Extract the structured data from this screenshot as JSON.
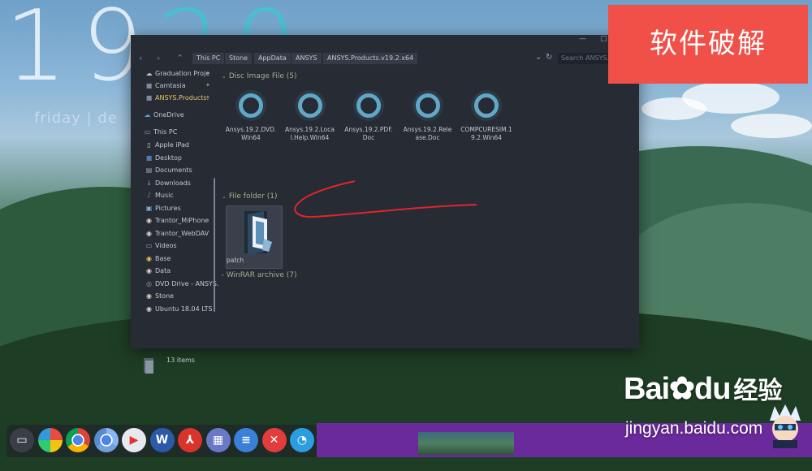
{
  "desktop": {
    "clock_digits": "19",
    "clock_accent": "20",
    "dateline": "friday | de"
  },
  "badge": {
    "text": "软件破解"
  },
  "explorer": {
    "window_controls": {
      "minimize": "—",
      "maximize": "□",
      "close": "✕"
    },
    "address": {
      "back": "‹",
      "forward": "›",
      "up": "⌃",
      "crumbs": [
        "This PC",
        "Stone",
        "AppData",
        "ANSYS",
        "ANSYS.Products.v19.2.x64"
      ],
      "dropdown": "⌄",
      "refresh": "↻",
      "search_placeholder": "Search ANSYS.Pro..."
    },
    "nav": {
      "quick_access": [
        {
          "label": "Graduation Proje",
          "icon": "☁",
          "pinned": true
        },
        {
          "label": "Camtasia",
          "icon": "■",
          "pinned": true
        },
        {
          "label": "ANSYS.Products.",
          "icon": "■",
          "pinned": true,
          "active": true
        }
      ],
      "onedrive": "OneDrive",
      "this_pc": "This PC",
      "pc_items": [
        {
          "label": "Apple iPad",
          "icon": "▯"
        },
        {
          "label": "Desktop",
          "icon": "■"
        },
        {
          "label": "Documents",
          "icon": "▤"
        },
        {
          "label": "Downloads",
          "icon": "↓"
        },
        {
          "label": "Music",
          "icon": "♪"
        },
        {
          "label": "Pictures",
          "icon": "▣"
        },
        {
          "label": "Trantor_MiPhone",
          "icon": "◉"
        },
        {
          "label": "Trantor_WebDAV",
          "icon": "◉"
        },
        {
          "label": "Videos",
          "icon": "▭"
        },
        {
          "label": "Base",
          "icon": "◉"
        },
        {
          "label": "Data",
          "icon": "◉"
        },
        {
          "label": "DVD Drive - ANSYS.",
          "icon": "◎"
        },
        {
          "label": "Stone",
          "icon": "◉"
        },
        {
          "label": "Ubuntu 18.04 LTS",
          "icon": "◉"
        }
      ]
    },
    "status": {
      "items": "13 items"
    },
    "groups": {
      "disc": {
        "header": "Disc Image File (5)",
        "files": [
          "Ansys.19.2.DVD.Win64",
          "Ansys.19.2.Local.Help.Win64",
          "Ansys.19.2.PDF.Doc",
          "Ansys.19.2.Release.Doc",
          "COMPCURESIM.19.2.Win64"
        ]
      },
      "folder": {
        "header": "File folder (1)",
        "files": [
          "patch"
        ]
      },
      "winrar": {
        "header": "WinRAR archive (7)"
      }
    }
  },
  "taskbar": {
    "apps": [
      {
        "name": "screen-app",
        "glyph": "▭",
        "color": "#3a3f47"
      },
      {
        "name": "colors-app",
        "glyph": "",
        "color": "#e9b930"
      },
      {
        "name": "chrome",
        "glyph": "",
        "color": "#d94c3b"
      },
      {
        "name": "chromium",
        "glyph": "",
        "color": "#4a86c5"
      },
      {
        "name": "video-app",
        "glyph": "▶",
        "color": "#e6eaee"
      },
      {
        "name": "word",
        "glyph": "W",
        "color": "#2b5aa8"
      },
      {
        "name": "pdf",
        "glyph": "⅄",
        "color": "#d8342c"
      },
      {
        "name": "docs-viewer",
        "glyph": "▦",
        "color": "#6a78c8"
      },
      {
        "name": "notes",
        "glyph": "≡",
        "color": "#3a7fd8"
      },
      {
        "name": "xmind",
        "glyph": "✕",
        "color": "#e23c3c"
      },
      {
        "name": "chat",
        "glyph": "◔",
        "color": "#2a9ee0"
      }
    ]
  },
  "watermark": {
    "logo": "Bai",
    "logo2": "du",
    "cn": "经验",
    "url": "jingyan.baidu.com"
  }
}
